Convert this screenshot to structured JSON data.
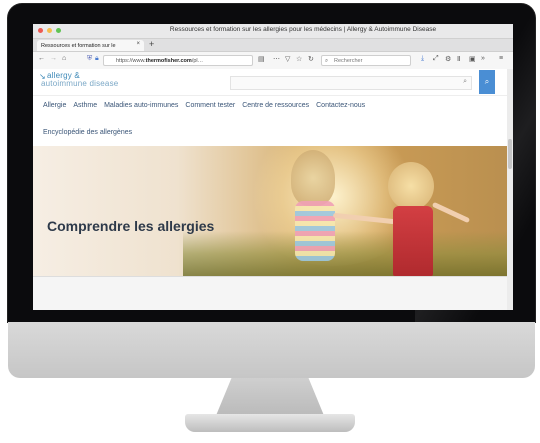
{
  "window": {
    "title": "Ressources et formation sur les allergies pour les médecins | Allergy & Autoimmune Disease",
    "dots": [
      "#ee5a52",
      "#f5be4f",
      "#60c454"
    ]
  },
  "tab": {
    "label": "Ressources et formation sur le",
    "close": "×",
    "new_tab": "+"
  },
  "toolbar": {
    "url_prefix": "https://www.",
    "url_domain": "thermofisher.com",
    "url_suffix": "/pl…",
    "search_placeholder": "Rechercher"
  },
  "site": {
    "logo_line1": "allergy &",
    "logo_line2": "autoimmune disease",
    "nav": [
      "Allergie",
      "Asthme",
      "Maladies auto-immunes",
      "Comment tester",
      "Centre de ressources",
      "Contactez-nous"
    ],
    "nav_second_line": "Encyclopédie des allergènes",
    "hero_title": "Comprendre les allergies"
  },
  "colors": {
    "accent": "#4a8ed4",
    "logo": "#3f8ab8",
    "nav_text": "#3a5577"
  }
}
